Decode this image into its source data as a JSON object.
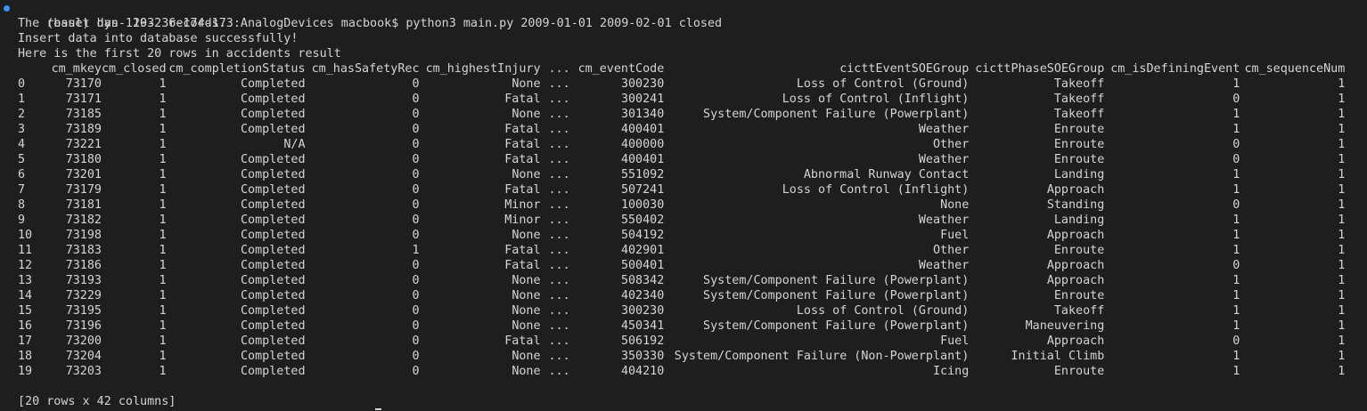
{
  "terminal": {
    "prompt_line": "(base) dyn-129-236-174-173:AnalogDevices macbook$ python3 main.py 2009-01-01 2009-02-01 closed",
    "output_lines": [
      "The result has  103  records.",
      "Insert data into database successfully!",
      "Here is the first 20 rows in accidents result"
    ],
    "footer": "[20 rows x 42 columns]"
  },
  "table": {
    "columns": [
      "",
      "cm_mkey",
      "cm_closed",
      "cm_completionStatus",
      "cm_hasSafetyRec",
      "cm_highestInjury",
      "...",
      "cm_eventCode",
      "cicttEventSOEGroup",
      "cicttPhaseSOEGroup",
      "cm_isDefiningEvent",
      "cm_sequenceNum"
    ],
    "rows": [
      [
        "0",
        "73170",
        "1",
        "Completed",
        "0",
        "None",
        "...",
        "300230",
        "Loss of Control (Ground)",
        "Takeoff",
        "1",
        "1"
      ],
      [
        "1",
        "73171",
        "1",
        "Completed",
        "0",
        "Fatal",
        "...",
        "300241",
        "Loss of Control (Inflight)",
        "Takeoff",
        "0",
        "1"
      ],
      [
        "2",
        "73185",
        "1",
        "Completed",
        "0",
        "None",
        "...",
        "301340",
        "System/Component Failure (Powerplant)",
        "Takeoff",
        "1",
        "1"
      ],
      [
        "3",
        "73189",
        "1",
        "Completed",
        "0",
        "Fatal",
        "...",
        "400401",
        "Weather",
        "Enroute",
        "1",
        "1"
      ],
      [
        "4",
        "73221",
        "1",
        "N/A",
        "0",
        "Fatal",
        "...",
        "400000",
        "Other",
        "Enroute",
        "0",
        "1"
      ],
      [
        "5",
        "73180",
        "1",
        "Completed",
        "0",
        "Fatal",
        "...",
        "400401",
        "Weather",
        "Enroute",
        "0",
        "1"
      ],
      [
        "6",
        "73201",
        "1",
        "Completed",
        "0",
        "None",
        "...",
        "551092",
        "Abnormal Runway Contact",
        "Landing",
        "1",
        "1"
      ],
      [
        "7",
        "73179",
        "1",
        "Completed",
        "0",
        "Fatal",
        "...",
        "507241",
        "Loss of Control (Inflight)",
        "Approach",
        "1",
        "1"
      ],
      [
        "8",
        "73181",
        "1",
        "Completed",
        "0",
        "Minor",
        "...",
        "100030",
        "None",
        "Standing",
        "0",
        "1"
      ],
      [
        "9",
        "73182",
        "1",
        "Completed",
        "0",
        "Minor",
        "...",
        "550402",
        "Weather",
        "Landing",
        "1",
        "1"
      ],
      [
        "10",
        "73198",
        "1",
        "Completed",
        "0",
        "None",
        "...",
        "504192",
        "Fuel",
        "Approach",
        "1",
        "1"
      ],
      [
        "11",
        "73183",
        "1",
        "Completed",
        "1",
        "Fatal",
        "...",
        "402901",
        "Other",
        "Enroute",
        "1",
        "1"
      ],
      [
        "12",
        "73186",
        "1",
        "Completed",
        "0",
        "Fatal",
        "...",
        "500401",
        "Weather",
        "Approach",
        "0",
        "1"
      ],
      [
        "13",
        "73193",
        "1",
        "Completed",
        "0",
        "None",
        "...",
        "508342",
        "System/Component Failure (Powerplant)",
        "Approach",
        "1",
        "1"
      ],
      [
        "14",
        "73229",
        "1",
        "Completed",
        "0",
        "None",
        "...",
        "402340",
        "System/Component Failure (Powerplant)",
        "Enroute",
        "1",
        "1"
      ],
      [
        "15",
        "73195",
        "1",
        "Completed",
        "0",
        "None",
        "...",
        "300230",
        "Loss of Control (Ground)",
        "Takeoff",
        "1",
        "1"
      ],
      [
        "16",
        "73196",
        "1",
        "Completed",
        "0",
        "None",
        "...",
        "450341",
        "System/Component Failure (Powerplant)",
        "Maneuvering",
        "1",
        "1"
      ],
      [
        "17",
        "73200",
        "1",
        "Completed",
        "0",
        "Fatal",
        "...",
        "506192",
        "Fuel",
        "Approach",
        "0",
        "1"
      ],
      [
        "18",
        "73204",
        "1",
        "Completed",
        "0",
        "None",
        "...",
        "350330",
        "System/Component Failure (Non-Powerplant)",
        "Initial Climb",
        "1",
        "1"
      ],
      [
        "19",
        "73203",
        "1",
        "Completed",
        "0",
        "None",
        "...",
        "404210",
        "Icing",
        "Enroute",
        "1",
        "1"
      ]
    ]
  },
  "colors": {
    "background": "#1e1e1e",
    "text": "#d4d4d4",
    "status_dot": "#3794ff"
  }
}
